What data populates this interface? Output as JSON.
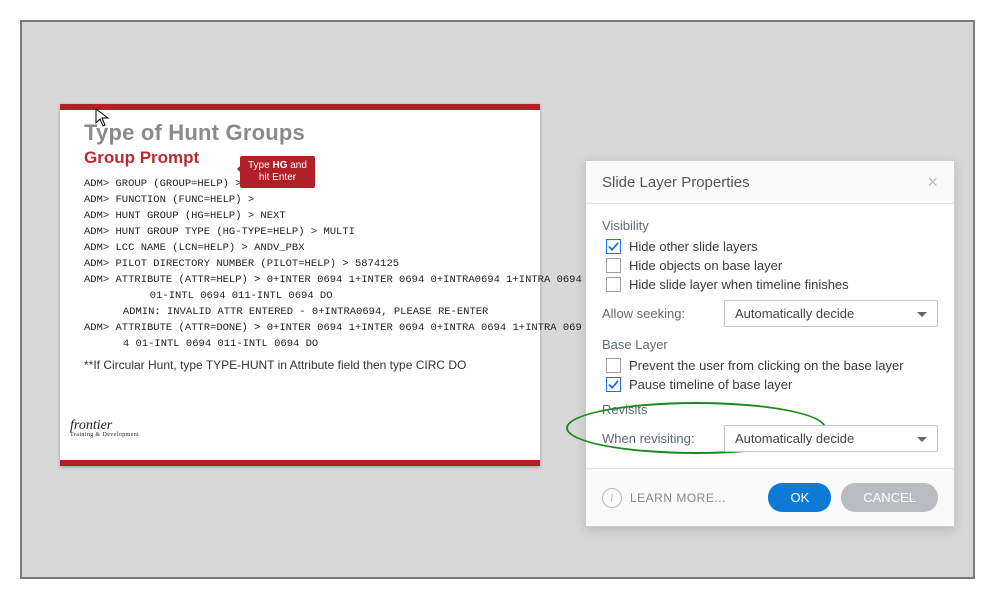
{
  "slide": {
    "title": "Type of Hunt Groups",
    "subtitle": "Group Prompt",
    "callout": "Type HG and hit Enter",
    "lines": [
      "ADM> GROUP (GROUP=HELP) >",
      "ADM> FUNCTION (FUNC=HELP) >",
      "ADM> HUNT GROUP (HG=HELP) > NEXT",
      "ADM> HUNT GROUP TYPE (HG-TYPE=HELP) > MULTI",
      "ADM> LCC NAME (LCN=HELP) > ANDV_PBX",
      "ADM> PILOT DIRECTORY NUMBER (PILOT=HELP) > 5874125",
      "ADM> ATTRIBUTE (ATTR=HELP) > 0+INTER 0694 1+INTER 0694 0+INTRA0694 1+INTRA 0694",
      "      01-INTL 0694 011-INTL 0694 DO",
      "   ADMIN: INVALID ATTR ENTERED - 0+INTRA0694, PLEASE RE-ENTER",
      "ADM> ATTRIBUTE (ATTR=DONE) > 0+INTER 0694 1+INTER 0694 0+INTRA 0694 1+INTRA 069",
      "   4 01-INTL 0694 011-INTL 0694 DO"
    ],
    "note": "**If Circular Hunt, type TYPE-HUNT in Attribute field then type CIRC DO",
    "brand": "frontier",
    "brand_sub": "Training & Development"
  },
  "dialog": {
    "title": "Slide Layer Properties",
    "visibility": {
      "label": "Visibility",
      "hide_other": {
        "label": "Hide other slide layers",
        "checked": true
      },
      "hide_objects": {
        "label": "Hide objects on base layer",
        "checked": false
      },
      "hide_finish": {
        "label": "Hide slide layer when timeline finishes",
        "checked": false
      },
      "allow_seeking_label": "Allow seeking:",
      "allow_seeking_value": "Automatically decide"
    },
    "base_layer": {
      "label": "Base Layer",
      "prevent_click": {
        "label": "Prevent the user from clicking on the base layer",
        "checked": false
      },
      "pause_timeline": {
        "label": "Pause timeline of base layer",
        "checked": true
      }
    },
    "revisits": {
      "label": "Revisits",
      "when_label": "When revisiting:",
      "when_value": "Automatically decide"
    },
    "learn_more": "LEARN MORE...",
    "ok": "OK",
    "cancel": "CANCEL"
  }
}
